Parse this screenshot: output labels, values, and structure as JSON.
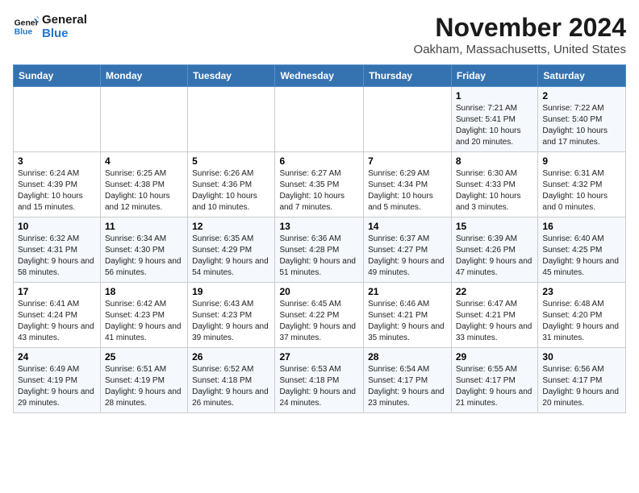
{
  "logo": {
    "line1": "General",
    "line2": "Blue"
  },
  "title": "November 2024",
  "location": "Oakham, Massachusetts, United States",
  "weekdays": [
    "Sunday",
    "Monday",
    "Tuesday",
    "Wednesday",
    "Thursday",
    "Friday",
    "Saturday"
  ],
  "weeks": [
    [
      {
        "day": "",
        "info": ""
      },
      {
        "day": "",
        "info": ""
      },
      {
        "day": "",
        "info": ""
      },
      {
        "day": "",
        "info": ""
      },
      {
        "day": "",
        "info": ""
      },
      {
        "day": "1",
        "info": "Sunrise: 7:21 AM\nSunset: 5:41 PM\nDaylight: 10 hours and 20 minutes."
      },
      {
        "day": "2",
        "info": "Sunrise: 7:22 AM\nSunset: 5:40 PM\nDaylight: 10 hours and 17 minutes."
      }
    ],
    [
      {
        "day": "3",
        "info": "Sunrise: 6:24 AM\nSunset: 4:39 PM\nDaylight: 10 hours and 15 minutes."
      },
      {
        "day": "4",
        "info": "Sunrise: 6:25 AM\nSunset: 4:38 PM\nDaylight: 10 hours and 12 minutes."
      },
      {
        "day": "5",
        "info": "Sunrise: 6:26 AM\nSunset: 4:36 PM\nDaylight: 10 hours and 10 minutes."
      },
      {
        "day": "6",
        "info": "Sunrise: 6:27 AM\nSunset: 4:35 PM\nDaylight: 10 hours and 7 minutes."
      },
      {
        "day": "7",
        "info": "Sunrise: 6:29 AM\nSunset: 4:34 PM\nDaylight: 10 hours and 5 minutes."
      },
      {
        "day": "8",
        "info": "Sunrise: 6:30 AM\nSunset: 4:33 PM\nDaylight: 10 hours and 3 minutes."
      },
      {
        "day": "9",
        "info": "Sunrise: 6:31 AM\nSunset: 4:32 PM\nDaylight: 10 hours and 0 minutes."
      }
    ],
    [
      {
        "day": "10",
        "info": "Sunrise: 6:32 AM\nSunset: 4:31 PM\nDaylight: 9 hours and 58 minutes."
      },
      {
        "day": "11",
        "info": "Sunrise: 6:34 AM\nSunset: 4:30 PM\nDaylight: 9 hours and 56 minutes."
      },
      {
        "day": "12",
        "info": "Sunrise: 6:35 AM\nSunset: 4:29 PM\nDaylight: 9 hours and 54 minutes."
      },
      {
        "day": "13",
        "info": "Sunrise: 6:36 AM\nSunset: 4:28 PM\nDaylight: 9 hours and 51 minutes."
      },
      {
        "day": "14",
        "info": "Sunrise: 6:37 AM\nSunset: 4:27 PM\nDaylight: 9 hours and 49 minutes."
      },
      {
        "day": "15",
        "info": "Sunrise: 6:39 AM\nSunset: 4:26 PM\nDaylight: 9 hours and 47 minutes."
      },
      {
        "day": "16",
        "info": "Sunrise: 6:40 AM\nSunset: 4:25 PM\nDaylight: 9 hours and 45 minutes."
      }
    ],
    [
      {
        "day": "17",
        "info": "Sunrise: 6:41 AM\nSunset: 4:24 PM\nDaylight: 9 hours and 43 minutes."
      },
      {
        "day": "18",
        "info": "Sunrise: 6:42 AM\nSunset: 4:23 PM\nDaylight: 9 hours and 41 minutes."
      },
      {
        "day": "19",
        "info": "Sunrise: 6:43 AM\nSunset: 4:23 PM\nDaylight: 9 hours and 39 minutes."
      },
      {
        "day": "20",
        "info": "Sunrise: 6:45 AM\nSunset: 4:22 PM\nDaylight: 9 hours and 37 minutes."
      },
      {
        "day": "21",
        "info": "Sunrise: 6:46 AM\nSunset: 4:21 PM\nDaylight: 9 hours and 35 minutes."
      },
      {
        "day": "22",
        "info": "Sunrise: 6:47 AM\nSunset: 4:21 PM\nDaylight: 9 hours and 33 minutes."
      },
      {
        "day": "23",
        "info": "Sunrise: 6:48 AM\nSunset: 4:20 PM\nDaylight: 9 hours and 31 minutes."
      }
    ],
    [
      {
        "day": "24",
        "info": "Sunrise: 6:49 AM\nSunset: 4:19 PM\nDaylight: 9 hours and 29 minutes."
      },
      {
        "day": "25",
        "info": "Sunrise: 6:51 AM\nSunset: 4:19 PM\nDaylight: 9 hours and 28 minutes."
      },
      {
        "day": "26",
        "info": "Sunrise: 6:52 AM\nSunset: 4:18 PM\nDaylight: 9 hours and 26 minutes."
      },
      {
        "day": "27",
        "info": "Sunrise: 6:53 AM\nSunset: 4:18 PM\nDaylight: 9 hours and 24 minutes."
      },
      {
        "day": "28",
        "info": "Sunrise: 6:54 AM\nSunset: 4:17 PM\nDaylight: 9 hours and 23 minutes."
      },
      {
        "day": "29",
        "info": "Sunrise: 6:55 AM\nSunset: 4:17 PM\nDaylight: 9 hours and 21 minutes."
      },
      {
        "day": "30",
        "info": "Sunrise: 6:56 AM\nSunset: 4:17 PM\nDaylight: 9 hours and 20 minutes."
      }
    ]
  ]
}
